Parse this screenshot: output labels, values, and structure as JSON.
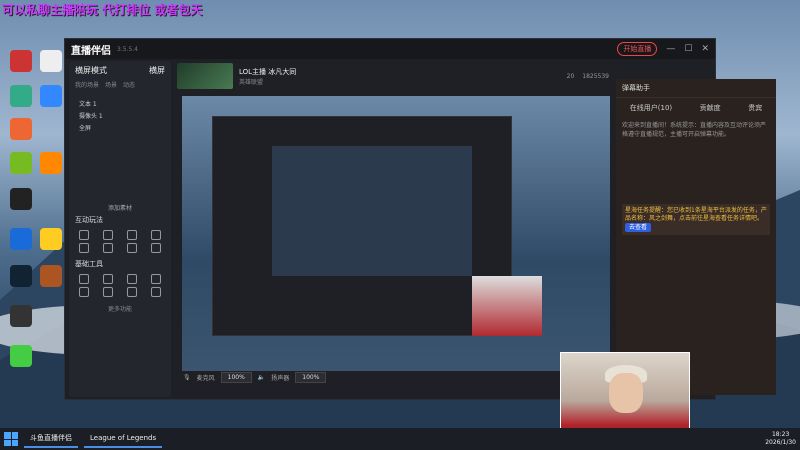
{
  "overlay": {
    "text": "可以私聊主播陪玩 代打排位 或者包天"
  },
  "window": {
    "app_name": "直播伴侣",
    "version": "3.5.5.4",
    "live_button": "开始直播"
  },
  "sidebar": {
    "mode": "横屏模式",
    "mode_suffix": "横屏",
    "tabs": [
      "我的场景",
      "场景",
      "动态"
    ],
    "scenes": [
      "文本 1",
      "摄像头 1",
      "全屏"
    ],
    "add_scene": "添加素材",
    "interactive_title": "互动玩法",
    "basic_title": "基础工具",
    "more": "更多功能"
  },
  "stream": {
    "title": "LOL主播 冰凡大同",
    "tag": "英雄联盟",
    "followers": "20",
    "viewers": "1825539"
  },
  "bottom": {
    "mic_label": "麦克风",
    "mic_vol": "100%",
    "speaker_label": "扬声器",
    "speaker_vol": "100%"
  },
  "right_panel": {
    "title": "弹幕助手",
    "tabs": [
      "在线用户(10)",
      "贡献度",
      "贵宾"
    ],
    "msg1": "欢迎来到直播间！系统提示：直播内容及互动评论须严格遵守直播规范，主播可开启弹幕功能。",
    "card": "星海任务提醒：您已收到1条星海平台派发的任务，产品名称：风之剑舞，点击前往星海查看任务详情吧。",
    "card_btn": "去查看"
  },
  "taskbar": {
    "items": [
      "斗鱼直播伴侣",
      "League of Legends"
    ],
    "time": "18:23",
    "date": "2026/1/30"
  }
}
